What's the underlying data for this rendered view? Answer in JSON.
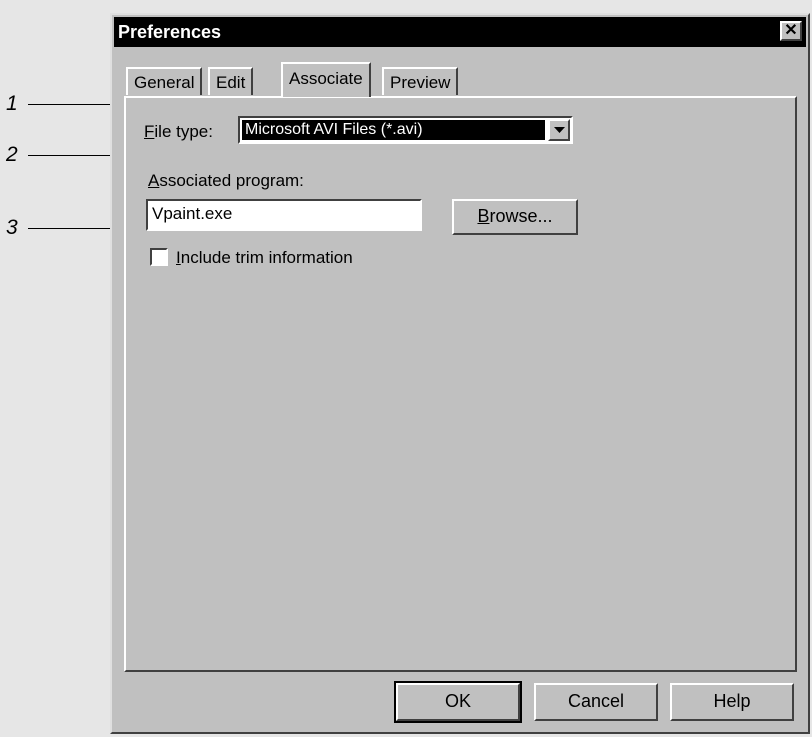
{
  "callouts": [
    "1",
    "2",
    "3"
  ],
  "window": {
    "title": "Preferences",
    "close_glyph": "✕"
  },
  "tabs": [
    {
      "label": "General",
      "active": false
    },
    {
      "label": "Edit",
      "active": false
    },
    {
      "label": "Associate",
      "active": true
    },
    {
      "label": "Preview",
      "active": false
    }
  ],
  "associate": {
    "file_type_label_mnemonic": "F",
    "file_type_label_rest": "ile type:",
    "file_type_value": "Microsoft AVI Files (*.avi)",
    "associated_program_label_mnemonic": "A",
    "associated_program_label_rest": "ssociated program:",
    "associated_program_value": "Vpaint.exe",
    "browse_label_mnemonic": "B",
    "browse_label_rest": "rowse...",
    "include_trim_mnemonic": "I",
    "include_trim_rest": "nclude trim information",
    "include_trim_checked": false
  },
  "footer": {
    "ok_label": "OK",
    "cancel_label": "Cancel",
    "help_label": "Help"
  }
}
